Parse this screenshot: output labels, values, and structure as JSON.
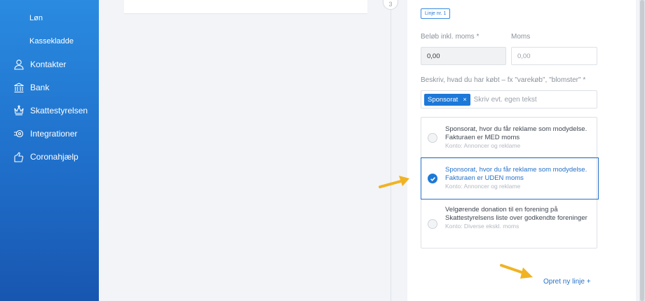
{
  "sidebar": {
    "sub_items": [
      "Løn",
      "Kassekladde"
    ],
    "items": [
      {
        "label": "Kontakter",
        "icon": "person-icon"
      },
      {
        "label": "Bank",
        "icon": "bank-icon"
      },
      {
        "label": "Skattestyrelsen",
        "icon": "crown-icon"
      },
      {
        "label": "Integrationer",
        "icon": "plug-icon"
      },
      {
        "label": "Coronahjælp",
        "icon": "hand-icon"
      }
    ]
  },
  "step": {
    "number": "3"
  },
  "form": {
    "line_badge": "Linje nr. 1",
    "amount_label": "Beløb inkl. moms *",
    "amount_value": "0,00",
    "vat_label": "Moms",
    "vat_placeholder": "0,00",
    "description_label": "Beskriv, hvad du har købt – fx \"varekøb\", \"blomster\" *",
    "tag": "Sponsorat",
    "tag_remove": "×",
    "tag_placeholder": "Skriv evt. egen tekst",
    "options": [
      {
        "text": "Sponsorat, hvor du får reklame som modydelse. Fakturaen er MED moms",
        "account": "Konto: Annoncer og reklame",
        "selected": false
      },
      {
        "text": "Sponsorat, hvor du får reklame som modydelse. Fakturaen er UDEN moms",
        "account": "Konto: Annoncer og reklame",
        "selected": true
      },
      {
        "text": "Velgørende donation til en forening på Skattestyrelsens liste over godkendte foreninger",
        "account": "Konto: Diverse ekskl. moms",
        "selected": false
      }
    ],
    "new_line": "Opret ny linje +"
  },
  "colors": {
    "accent": "#1d78d8",
    "sidebar": "#1f6fca",
    "arrow": "#f0b323"
  }
}
